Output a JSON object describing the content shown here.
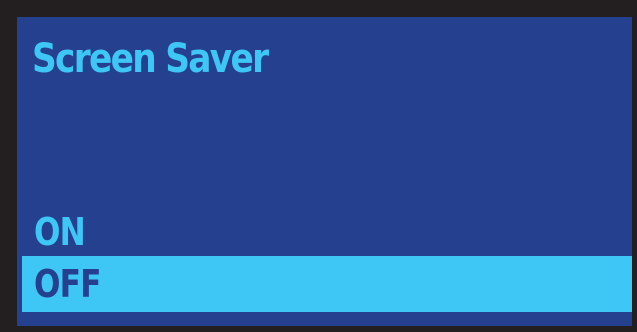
{
  "screen": {
    "title": "Screen Saver"
  },
  "options": [
    {
      "label": "ON",
      "selected": false
    },
    {
      "label": "OFF",
      "selected": true
    }
  ],
  "colors": {
    "bezel": "#231f20",
    "screen_background": "#25408f",
    "accent": "#3ec6f4"
  }
}
